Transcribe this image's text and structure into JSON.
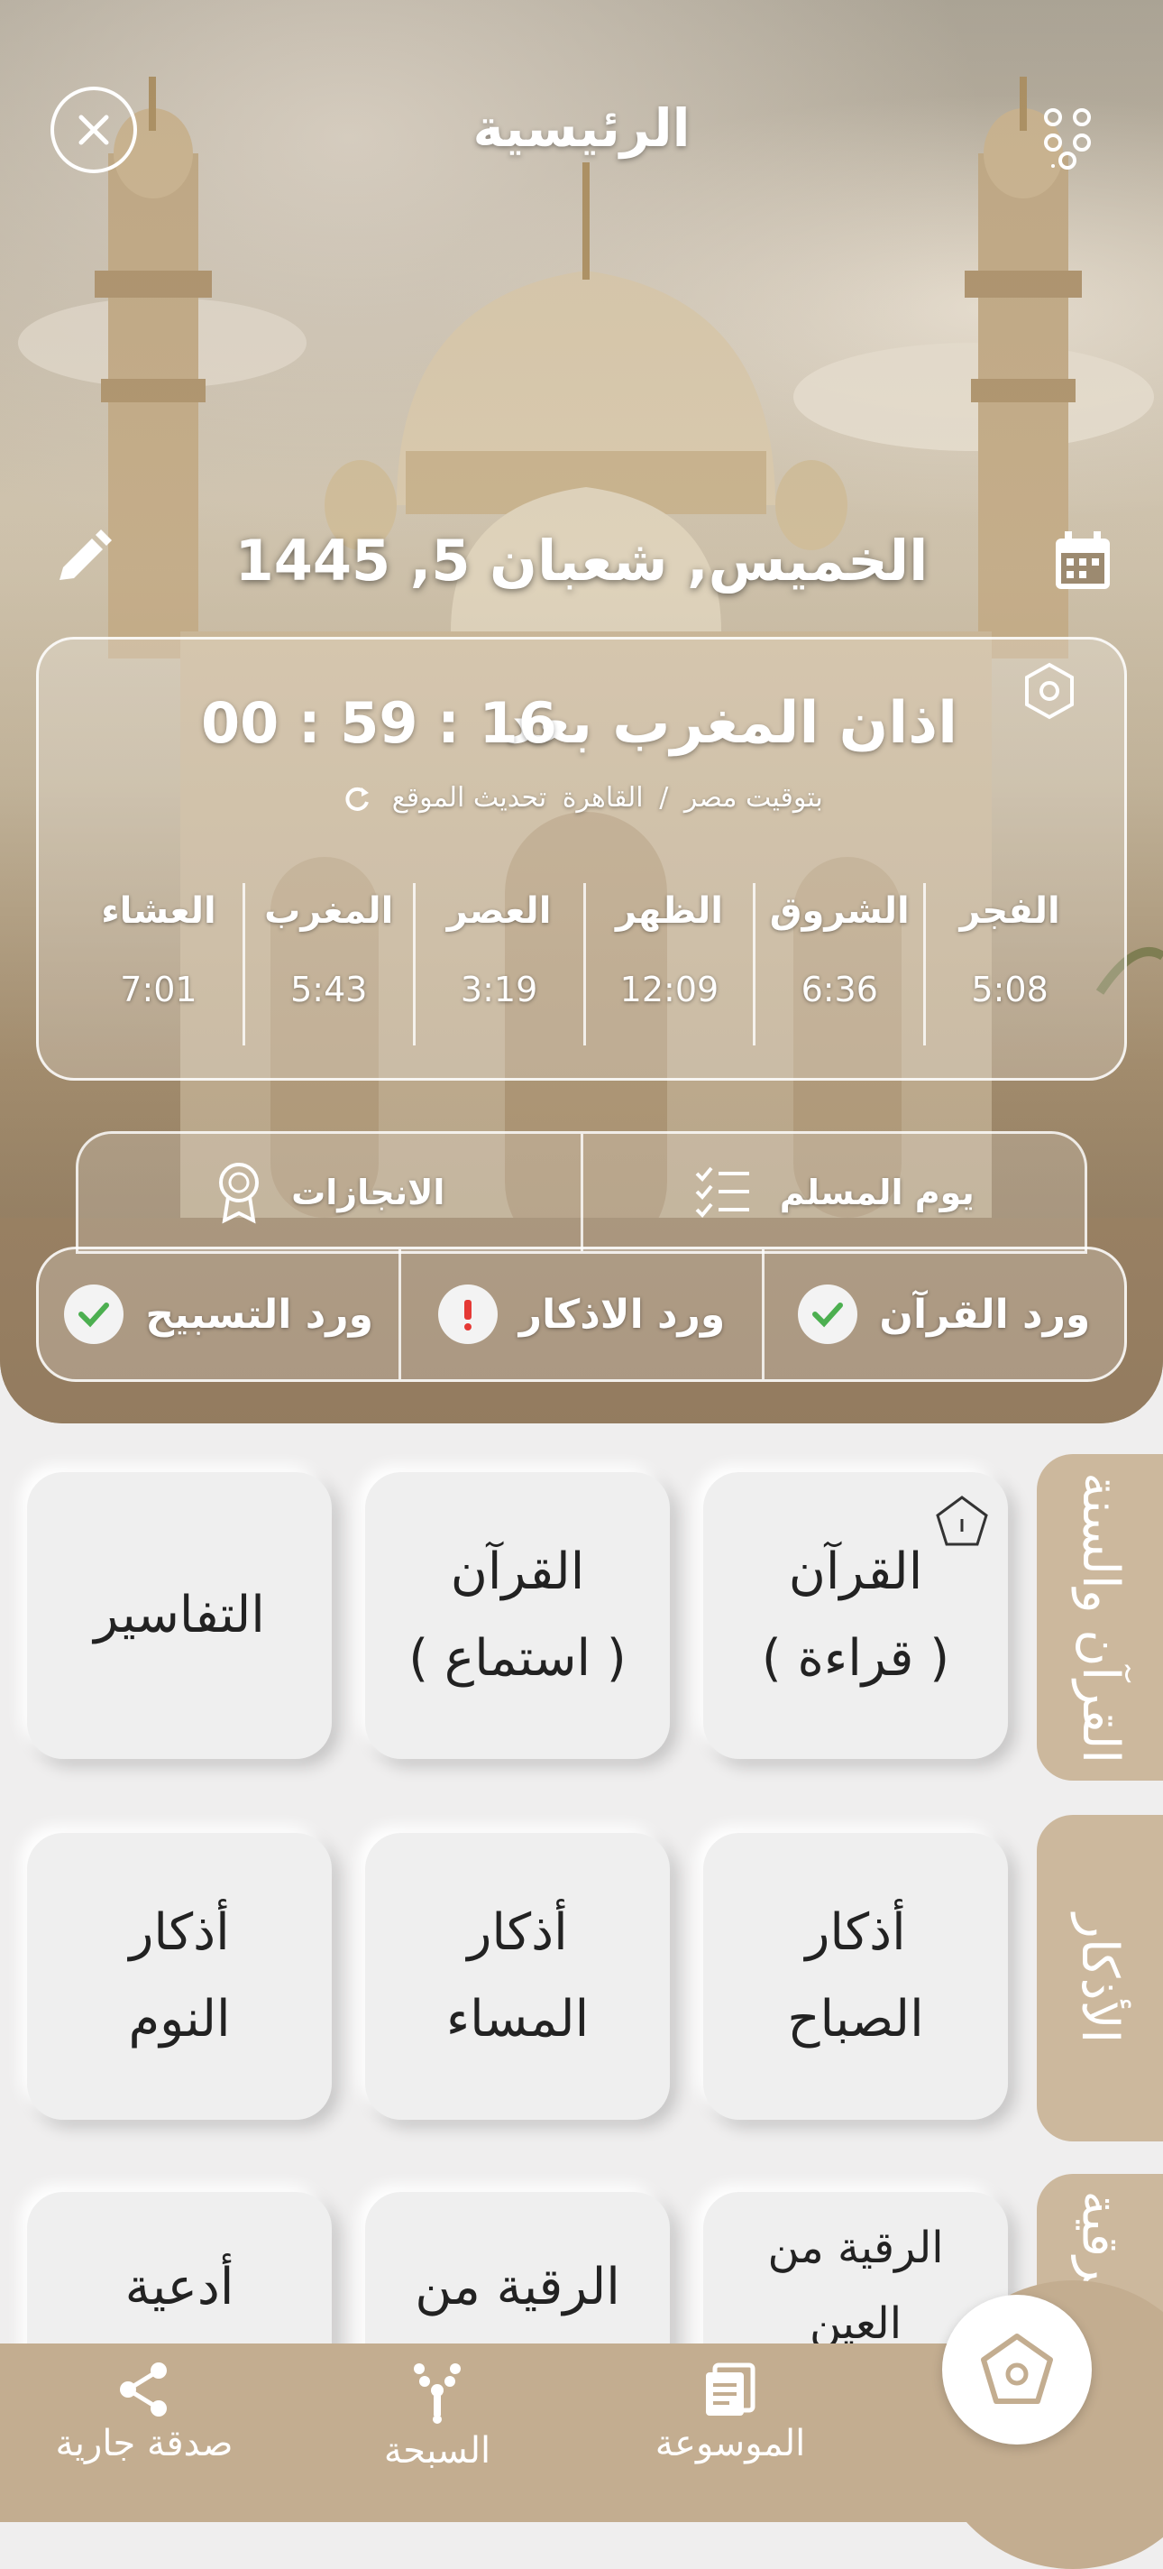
{
  "header": {
    "title": "الرئيسية"
  },
  "date": {
    "text": "الخميس, شعبان 5, 1445"
  },
  "adhan": {
    "label": "اذان المغرب بعد",
    "countdown": "00 : 59 : 16",
    "location_prefix": "بتوقيت مصر",
    "separator": "/",
    "city": "القاهرة",
    "refresh_label": "تحديث الموقع"
  },
  "prayers": [
    {
      "name": "الفجر",
      "time": "5:08"
    },
    {
      "name": "الشروق",
      "time": "6:36"
    },
    {
      "name": "الظهر",
      "time": "12:09"
    },
    {
      "name": "العصر",
      "time": "3:19"
    },
    {
      "name": "المغرب",
      "time": "5:43"
    },
    {
      "name": "العشاء",
      "time": "7:01"
    }
  ],
  "tabs_top": [
    {
      "label": "يوم المسلم"
    },
    {
      "label": "الانجازات"
    }
  ],
  "tabs_wird": [
    {
      "label": "ورد القرآن",
      "status": "done"
    },
    {
      "label": "ورد الاذكار",
      "status": "pending"
    },
    {
      "label": "ورد التسبيح",
      "status": "done"
    }
  ],
  "sections": {
    "quran": "القرآن والسنة",
    "adhkar": "الأذكار",
    "ruqya": "والرقية"
  },
  "tiles": {
    "quran_read": {
      "l1": "القرآن",
      "l2": "( قراءة )"
    },
    "quran_listen": {
      "l1": "القرآن",
      "l2": "( استماع )"
    },
    "tafasir": {
      "l1": "التفاسير"
    },
    "morning": {
      "l1": "أذكار",
      "l2": "الصباح"
    },
    "evening": {
      "l1": "أذكار",
      "l2": "المساء"
    },
    "sleep": {
      "l1": "أذكار",
      "l2": "النوم"
    },
    "ruqya_eye": {
      "l1": "الرقية من",
      "l2": "العين"
    },
    "ruqya_from": {
      "l1": "الرقية من"
    },
    "duas": {
      "l1": "أدعية"
    }
  },
  "bottom_nav": {
    "encyclopedia": "الموسوعة",
    "tasbeeh": "السبحة",
    "charity": "صدقة جارية"
  },
  "colors": {
    "accent": "#c3ad90",
    "side_tab": "#ccb89d",
    "check_green": "#4caf50",
    "warn_red": "#e53935"
  }
}
